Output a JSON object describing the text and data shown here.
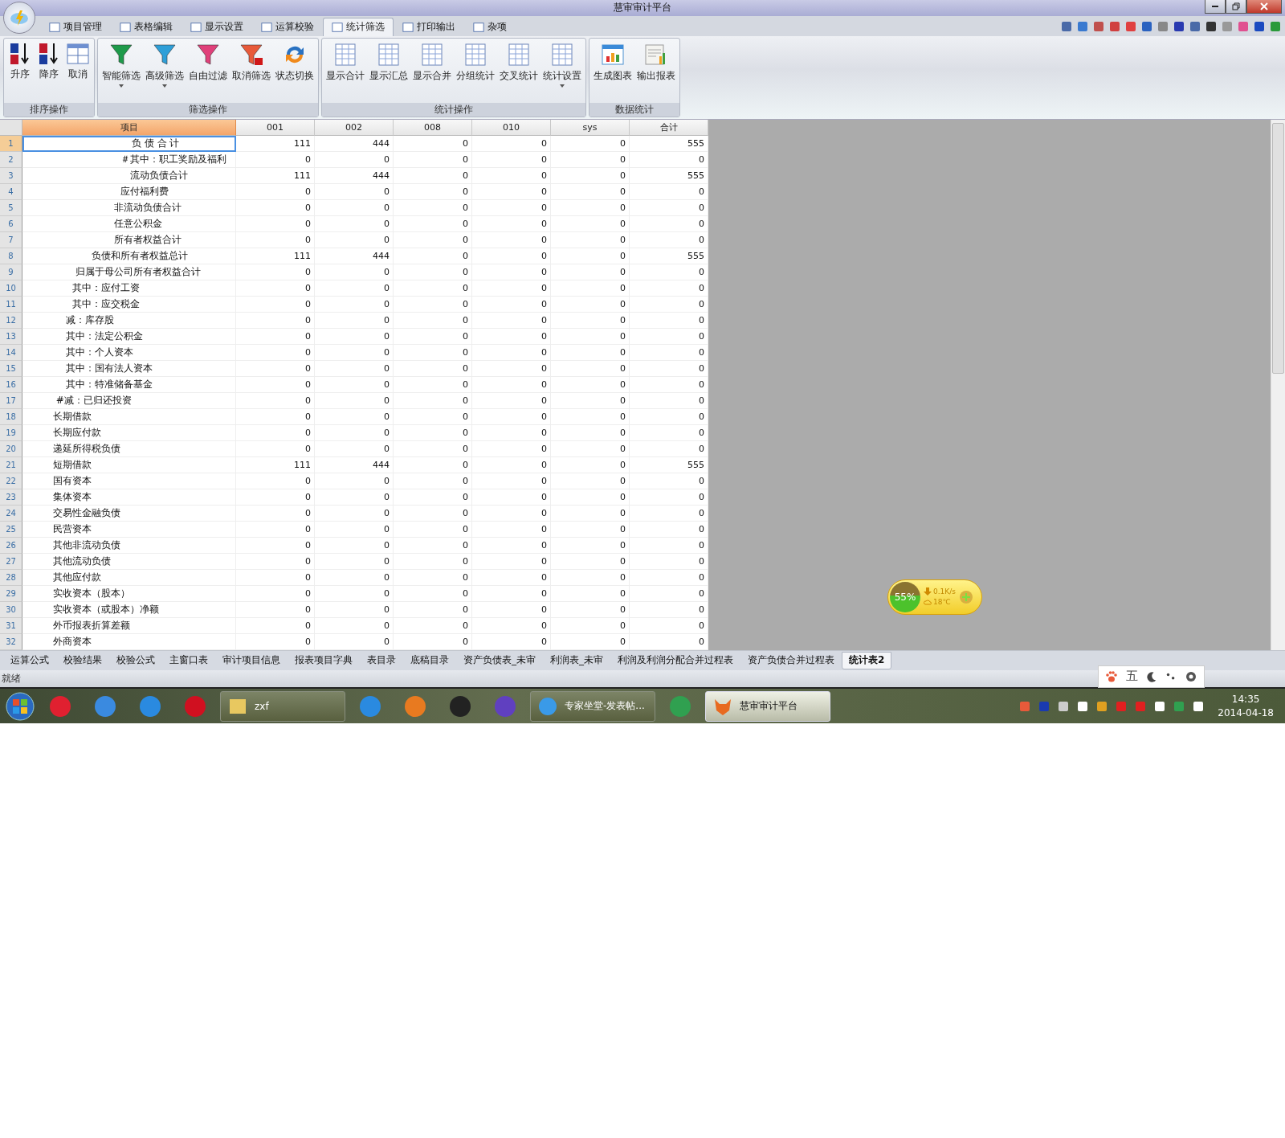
{
  "window": {
    "title": "慧审审计平台"
  },
  "menu_tabs": [
    {
      "label": "项目管理",
      "selected": false
    },
    {
      "label": "表格编辑",
      "selected": false
    },
    {
      "label": "显示设置",
      "selected": false
    },
    {
      "label": "运算校验",
      "selected": false
    },
    {
      "label": "统计筛选",
      "selected": true
    },
    {
      "label": "打印输出",
      "selected": false
    },
    {
      "label": "杂项",
      "selected": false
    }
  ],
  "ribbon_groups": [
    {
      "title": "排序操作",
      "buttons": [
        {
          "label": "升序",
          "has_dropdown": false
        },
        {
          "label": "降序",
          "has_dropdown": false
        },
        {
          "label": "取消",
          "has_dropdown": false
        }
      ]
    },
    {
      "title": "筛选操作",
      "buttons": [
        {
          "label": "智能筛选",
          "has_dropdown": true
        },
        {
          "label": "高级筛选",
          "has_dropdown": true
        },
        {
          "label": "自由过滤",
          "has_dropdown": false
        },
        {
          "label": "取消筛选",
          "has_dropdown": false
        },
        {
          "label": "状态切换",
          "has_dropdown": false
        }
      ]
    },
    {
      "title": "统计操作",
      "buttons": [
        {
          "label": "显示合计",
          "has_dropdown": false
        },
        {
          "label": "显示汇总",
          "has_dropdown": false
        },
        {
          "label": "显示合并",
          "has_dropdown": false
        },
        {
          "label": "分组统计",
          "has_dropdown": false
        },
        {
          "label": "交叉统计",
          "has_dropdown": false
        },
        {
          "label": "统计设置",
          "has_dropdown": true
        }
      ]
    },
    {
      "title": "数据统计",
      "buttons": [
        {
          "label": "生成图表",
          "has_dropdown": false
        },
        {
          "label": "输出报表",
          "has_dropdown": false
        }
      ]
    }
  ],
  "table": {
    "columns": [
      {
        "label": "项目",
        "selected": true
      },
      {
        "label": "001",
        "selected": false
      },
      {
        "label": "002",
        "selected": false
      },
      {
        "label": "008",
        "selected": false
      },
      {
        "label": "010",
        "selected": false
      },
      {
        "label": "sys",
        "selected": false
      },
      {
        "label": "合计",
        "selected": false
      }
    ],
    "rows": [
      {
        "n": "1",
        "item": "　　　　　　　　　　　负 债 合 计",
        "values": [
          "111",
          "444",
          "0",
          "0",
          "0",
          "555"
        ],
        "selected": true
      },
      {
        "n": "2",
        "item": "　　　　　　　　　　＃其中：职工奖励及福利",
        "values": [
          "0",
          "0",
          "0",
          "0",
          "0",
          "0"
        ],
        "selected": false
      },
      {
        "n": "3",
        "item": "　　　　　　　　　　　流动负债合计",
        "values": [
          "111",
          "444",
          "0",
          "0",
          "0",
          "555"
        ],
        "selected": false
      },
      {
        "n": "4",
        "item": "　　　　　　　　　　应付福利费",
        "values": [
          "0",
          "0",
          "0",
          "0",
          "0",
          "0"
        ],
        "selected": false
      },
      {
        "n": "5",
        "item": "　　　　　　　　　 非流动负债合计",
        "values": [
          "0",
          "0",
          "0",
          "0",
          "0",
          "0"
        ],
        "selected": false
      },
      {
        "n": "6",
        "item": "　　　　　　　　　 任意公积金",
        "values": [
          "0",
          "0",
          "0",
          "0",
          "0",
          "0"
        ],
        "selected": false
      },
      {
        "n": "7",
        "item": "　　　　　　　　　 所有者权益合计",
        "values": [
          "0",
          "0",
          "0",
          "0",
          "0",
          "0"
        ],
        "selected": false
      },
      {
        "n": "8",
        "item": "　　　　　　　负债和所有者权益总计",
        "values": [
          "111",
          "444",
          "0",
          "0",
          "0",
          "555"
        ],
        "selected": false
      },
      {
        "n": "9",
        "item": "　　　　　 归属于母公司所有者权益合计",
        "values": [
          "0",
          "0",
          "0",
          "0",
          "0",
          "0"
        ],
        "selected": false
      },
      {
        "n": "10",
        "item": "　　　　　其中：应付工资",
        "values": [
          "0",
          "0",
          "0",
          "0",
          "0",
          "0"
        ],
        "selected": false
      },
      {
        "n": "11",
        "item": "　　　　　其中：应交税金",
        "values": [
          "0",
          "0",
          "0",
          "0",
          "0",
          "0"
        ],
        "selected": false
      },
      {
        "n": "12",
        "item": "　　　　 减：库存股",
        "values": [
          "0",
          "0",
          "0",
          "0",
          "0",
          "0"
        ],
        "selected": false
      },
      {
        "n": "13",
        "item": "　　　　 其中：法定公积金",
        "values": [
          "0",
          "0",
          "0",
          "0",
          "0",
          "0"
        ],
        "selected": false
      },
      {
        "n": "14",
        "item": "　　　　 其中：个人资本",
        "values": [
          "0",
          "0",
          "0",
          "0",
          "0",
          "0"
        ],
        "selected": false
      },
      {
        "n": "15",
        "item": "　　　　 其中：国有法人资本",
        "values": [
          "0",
          "0",
          "0",
          "0",
          "0",
          "0"
        ],
        "selected": false
      },
      {
        "n": "16",
        "item": "　　　　 其中：特准储备基金",
        "values": [
          "0",
          "0",
          "0",
          "0",
          "0",
          "0"
        ],
        "selected": false
      },
      {
        "n": "17",
        "item": "　　　 #减：已归还投资",
        "values": [
          "0",
          "0",
          "0",
          "0",
          "0",
          "0"
        ],
        "selected": false
      },
      {
        "n": "18",
        "item": "　　　长期借款",
        "values": [
          "0",
          "0",
          "0",
          "0",
          "0",
          "0"
        ],
        "selected": false
      },
      {
        "n": "19",
        "item": "　　　长期应付款",
        "values": [
          "0",
          "0",
          "0",
          "0",
          "0",
          "0"
        ],
        "selected": false
      },
      {
        "n": "20",
        "item": "　　　递延所得税负债",
        "values": [
          "0",
          "0",
          "0",
          "0",
          "0",
          "0"
        ],
        "selected": false
      },
      {
        "n": "21",
        "item": "　　　短期借款",
        "values": [
          "111",
          "444",
          "0",
          "0",
          "0",
          "555"
        ],
        "selected": false
      },
      {
        "n": "22",
        "item": "　　　国有资本",
        "values": [
          "0",
          "0",
          "0",
          "0",
          "0",
          "0"
        ],
        "selected": false
      },
      {
        "n": "23",
        "item": "　　　集体资本",
        "values": [
          "0",
          "0",
          "0",
          "0",
          "0",
          "0"
        ],
        "selected": false
      },
      {
        "n": "24",
        "item": "　　　交易性金融负债",
        "values": [
          "0",
          "0",
          "0",
          "0",
          "0",
          "0"
        ],
        "selected": false
      },
      {
        "n": "25",
        "item": "　　　民营资本",
        "values": [
          "0",
          "0",
          "0",
          "0",
          "0",
          "0"
        ],
        "selected": false
      },
      {
        "n": "26",
        "item": "　　　其他非流动负债",
        "values": [
          "0",
          "0",
          "0",
          "0",
          "0",
          "0"
        ],
        "selected": false
      },
      {
        "n": "27",
        "item": "　　　其他流动负债",
        "values": [
          "0",
          "0",
          "0",
          "0",
          "0",
          "0"
        ],
        "selected": false
      },
      {
        "n": "28",
        "item": "　　　其他应付款",
        "values": [
          "0",
          "0",
          "0",
          "0",
          "0",
          "0"
        ],
        "selected": false
      },
      {
        "n": "29",
        "item": "　　　实收资本（股本）",
        "values": [
          "0",
          "0",
          "0",
          "0",
          "0",
          "0"
        ],
        "selected": false
      },
      {
        "n": "30",
        "item": "　　　实收资本（或股本）净额",
        "values": [
          "0",
          "0",
          "0",
          "0",
          "0",
          "0"
        ],
        "selected": false
      },
      {
        "n": "31",
        "item": "　　　外币报表折算差额",
        "values": [
          "0",
          "0",
          "0",
          "0",
          "0",
          "0"
        ],
        "selected": false
      },
      {
        "n": "32",
        "item": "　　　外商资本",
        "values": [
          "0",
          "0",
          "0",
          "0",
          "0",
          "0"
        ],
        "selected": false
      }
    ]
  },
  "sheet_tabs": [
    {
      "label": "运算公式",
      "selected": false
    },
    {
      "label": "校验结果",
      "selected": false
    },
    {
      "label": "校验公式",
      "selected": false
    },
    {
      "label": "主窗口表",
      "selected": false
    },
    {
      "label": "审计项目信息",
      "selected": false
    },
    {
      "label": "报表项目字典",
      "selected": false
    },
    {
      "label": "表目录",
      "selected": false
    },
    {
      "label": "底稿目录",
      "selected": false
    },
    {
      "label": "资产负债表_未审",
      "selected": false
    },
    {
      "label": "利润表_未审",
      "selected": false
    },
    {
      "label": "利润及利润分配合并过程表",
      "selected": false
    },
    {
      "label": "资产负债合并过程表",
      "selected": false
    },
    {
      "label": "统计表2",
      "selected": true
    }
  ],
  "status_bar": {
    "text": "就绪"
  },
  "net_widget": {
    "percent": "55%",
    "speed": "0.1K/s",
    "temperature": "18℃"
  },
  "ime_bar": {
    "mode": "五"
  },
  "taskbar": {
    "windows": [
      {
        "label": "zxf",
        "selected": false
      },
      {
        "label": "专家坐堂-发表帖...",
        "selected": false
      },
      {
        "label": "慧审审计平台",
        "selected": true
      }
    ],
    "time": "14:35",
    "date": "2014-04-18"
  }
}
